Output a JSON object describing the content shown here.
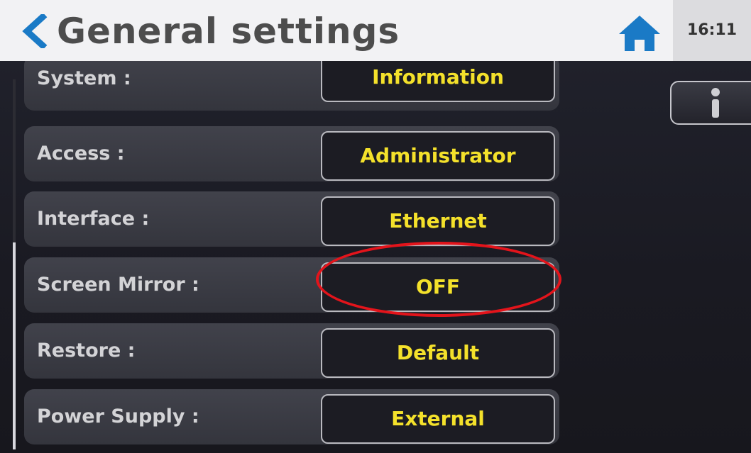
{
  "header": {
    "title": "General settings",
    "time": "16:11",
    "back_icon": "chevron-left-icon",
    "home_icon": "home-icon",
    "accent_color": "#1a7ac6"
  },
  "settings": [
    {
      "label": "System :",
      "value": "Information"
    },
    {
      "label": "Access :",
      "value": "Administrator"
    },
    {
      "label": "Interface :",
      "value": "Ethernet"
    },
    {
      "label": "Screen Mirror :",
      "value": "OFF"
    },
    {
      "label": "Restore :",
      "value": "Default"
    },
    {
      "label": "Power Supply :",
      "value": "External"
    }
  ],
  "info_button": {
    "icon": "info-icon"
  },
  "colors": {
    "value_text": "#f4e12b",
    "highlight": "#e3141b"
  }
}
